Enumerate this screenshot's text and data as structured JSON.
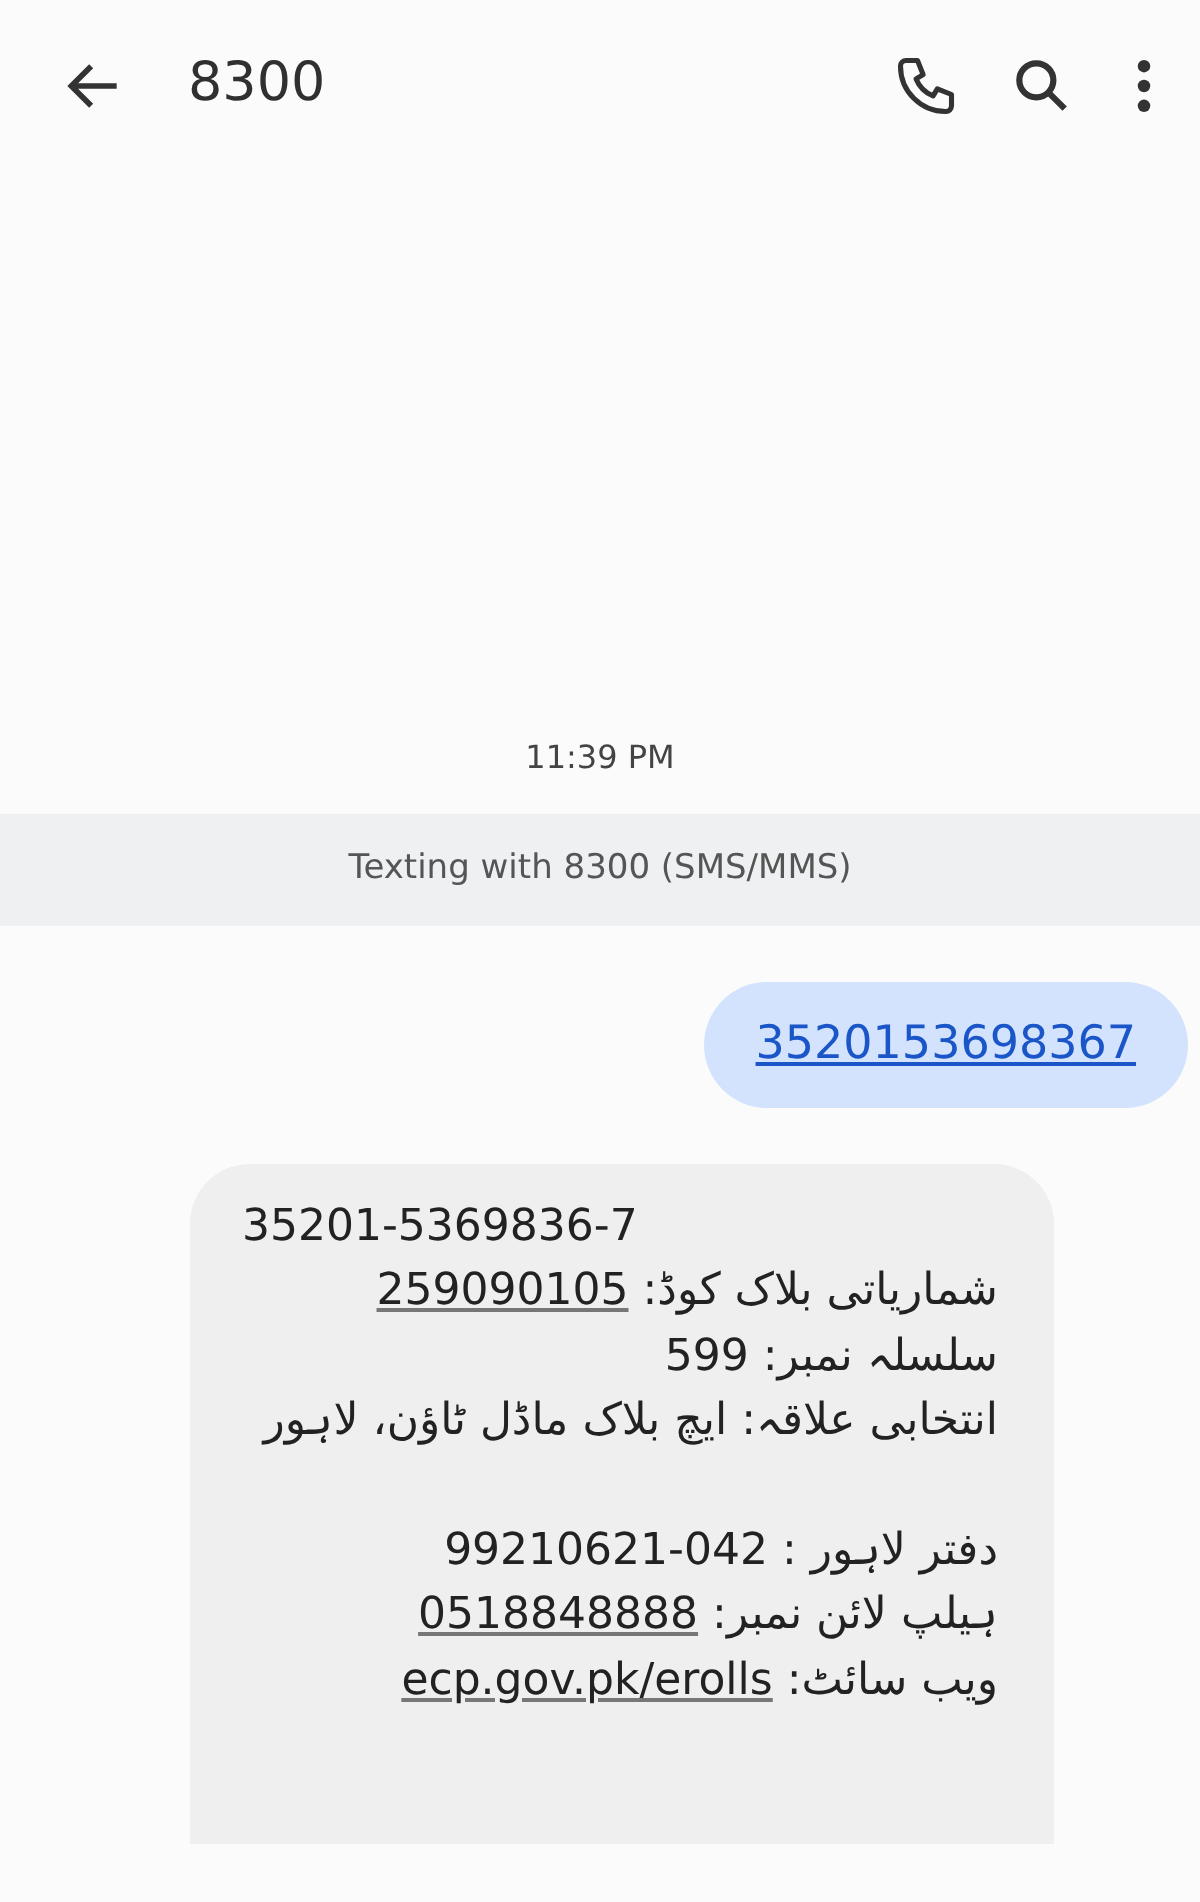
{
  "header": {
    "title": "8300"
  },
  "timestamp": "11:39 PM",
  "banner": "Texting with 8300 (SMS/MMS)",
  "sent": {
    "text": "3520153698367",
    "link": true
  },
  "received": {
    "lines": [
      {
        "kind": "ltr",
        "value": "35201-5369836-7",
        "link": false
      },
      {
        "kind": "rtl",
        "label": "شماریاتی بلاک کوڈ:",
        "value": "259090105",
        "link": true
      },
      {
        "kind": "rtl",
        "label": "سلسلہ نمبر:",
        "value": "599",
        "link": false
      },
      {
        "kind": "rtl",
        "label": "انتخابی علاقہ: ایچ بلاک ماڈل ٹاؤن، لاہور"
      },
      {
        "kind": "blank"
      },
      {
        "kind": "rtl",
        "label": "دفتر لاہور :",
        "value": "99210621-042",
        "link": false
      },
      {
        "kind": "rtl",
        "label": "ہیلپ لائن نمبر:",
        "value": "0518848888",
        "link": true
      },
      {
        "kind": "rtl",
        "label": "ویب سائٹ:",
        "value": "ecp.gov.pk/erolls",
        "link": true
      }
    ]
  }
}
